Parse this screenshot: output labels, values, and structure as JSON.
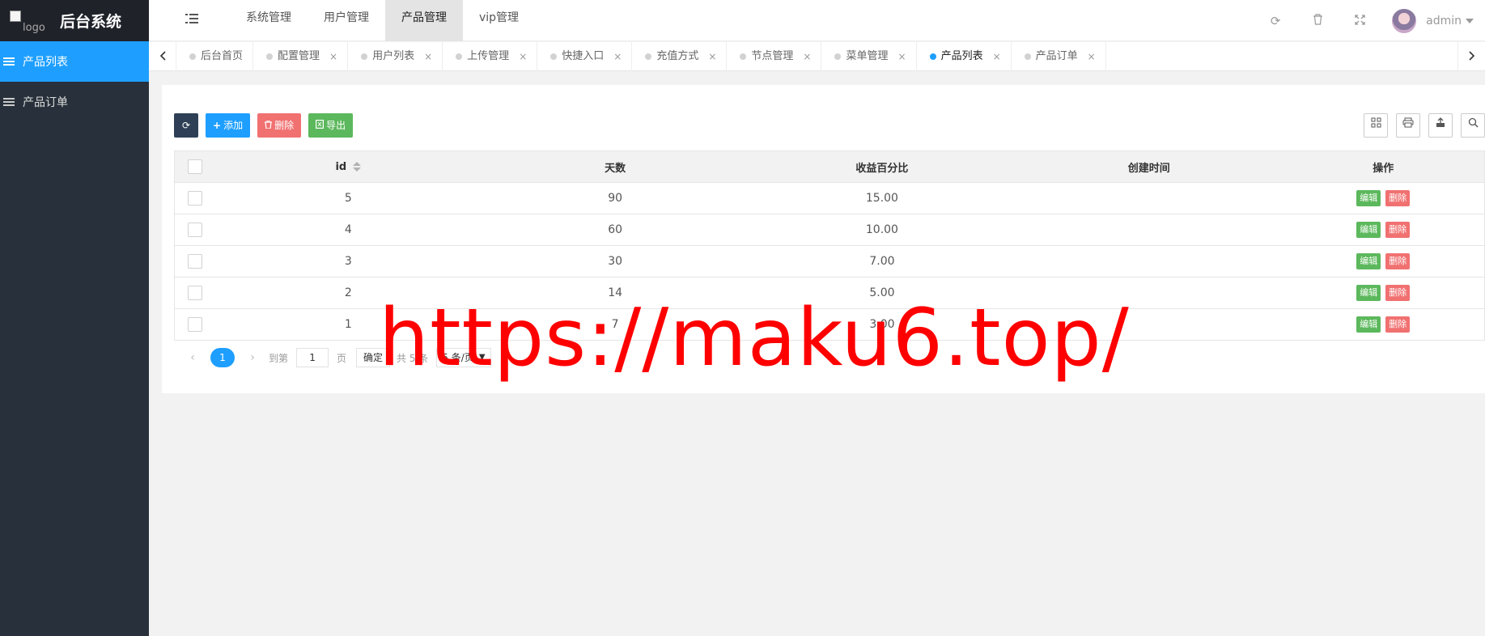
{
  "app": {
    "logo_alt": "logo",
    "title": "后台系统"
  },
  "sidebar": {
    "items": [
      {
        "label": "产品列表",
        "active": true
      },
      {
        "label": "产品订单",
        "active": false
      }
    ]
  },
  "topnav": {
    "items": [
      {
        "label": "系统管理",
        "active": false
      },
      {
        "label": "用户管理",
        "active": false
      },
      {
        "label": "产品管理",
        "active": true
      },
      {
        "label": "vip管理",
        "active": false
      }
    ],
    "user": "admin",
    "icons": [
      "refresh-icon",
      "trash-icon",
      "fullscreen-icon"
    ]
  },
  "tabs": {
    "items": [
      {
        "label": "后台首页",
        "closable": false,
        "active": false
      },
      {
        "label": "配置管理",
        "closable": true,
        "active": false
      },
      {
        "label": "用户列表",
        "closable": true,
        "active": false
      },
      {
        "label": "上传管理",
        "closable": true,
        "active": false
      },
      {
        "label": "快捷入口",
        "closable": true,
        "active": false
      },
      {
        "label": "充值方式",
        "closable": true,
        "active": false
      },
      {
        "label": "节点管理",
        "closable": true,
        "active": false
      },
      {
        "label": "菜单管理",
        "closable": true,
        "active": false
      },
      {
        "label": "产品列表",
        "closable": true,
        "active": true
      },
      {
        "label": "产品订单",
        "closable": true,
        "active": false
      }
    ],
    "close_glyph": "×"
  },
  "toolbar": {
    "add_label": "添加",
    "delete_label": "删除",
    "export_label": "导出"
  },
  "table": {
    "headers": [
      "id",
      "天数",
      "收益百分比",
      "创建时间",
      "操作"
    ],
    "rows": [
      {
        "id": "5",
        "days": "90",
        "rate": "15.00",
        "created": ""
      },
      {
        "id": "4",
        "days": "60",
        "rate": "10.00",
        "created": ""
      },
      {
        "id": "3",
        "days": "30",
        "rate": "7.00",
        "created": ""
      },
      {
        "id": "2",
        "days": "14",
        "rate": "5.00",
        "created": ""
      },
      {
        "id": "1",
        "days": "7",
        "rate": "3.00",
        "created": ""
      }
    ],
    "edit_label": "编辑",
    "delete_label": "删除"
  },
  "pager": {
    "current": "1",
    "goto_label": "到第",
    "goto_value": "1",
    "page_unit": "页",
    "confirm_label": "确定",
    "total_label": "共 5 条",
    "per_page_label": "5 条/页"
  },
  "watermark": "https://maku6.top/",
  "colors": {
    "sidebar_bg": "#28313b",
    "accent": "#1e9fff",
    "danger": "#f17171",
    "success": "#5cb85c",
    "watermark": "#ff0000"
  }
}
